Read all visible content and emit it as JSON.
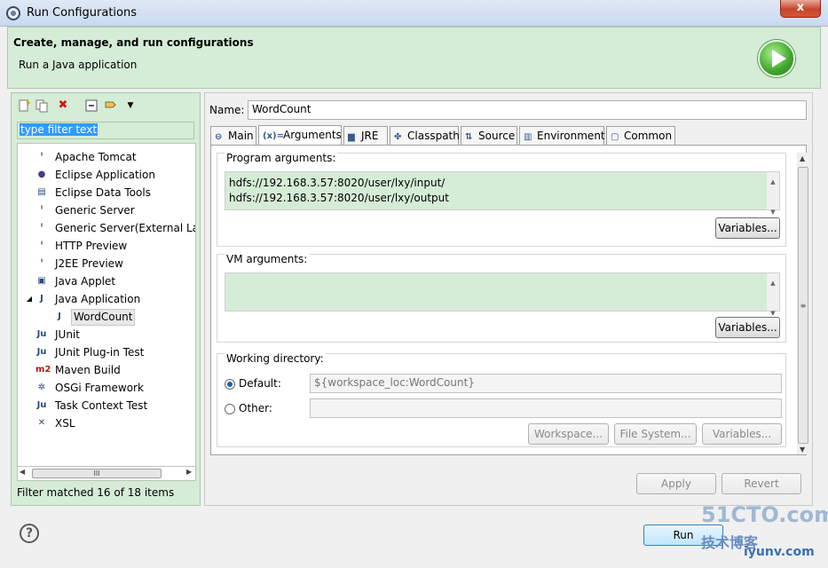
{
  "window": {
    "title": "Run Configurations",
    "close": "x"
  },
  "header": {
    "title": "Create, manage, and run configurations",
    "subtitle": "Run a Java application"
  },
  "left": {
    "toolbar": [
      "new-launch-icon",
      "duplicate-icon",
      "delete-icon",
      "collapse-all-icon",
      "filter-icon",
      "chevron-down-icon"
    ],
    "filter_text": "type filter text",
    "tree": [
      {
        "label": "Apache Tomcat",
        "icon": "ᴵ",
        "depth": 1
      },
      {
        "label": "Eclipse Application",
        "icon": "●",
        "depth": 1
      },
      {
        "label": "Eclipse Data Tools",
        "icon": "▤",
        "depth": 1
      },
      {
        "label": "Generic Server",
        "icon": "ᴵ",
        "depth": 1
      },
      {
        "label": "Generic Server(External Lau",
        "icon": "ᴵ",
        "depth": 1
      },
      {
        "label": "HTTP Preview",
        "icon": "ᴵ",
        "depth": 1
      },
      {
        "label": "J2EE Preview",
        "icon": "ᴵ",
        "depth": 1
      },
      {
        "label": "Java Applet",
        "icon": "▣",
        "depth": 1
      },
      {
        "label": "Java Application",
        "icon": "J",
        "depth": 1,
        "expanded": true
      },
      {
        "label": "WordCount",
        "icon": "J",
        "depth": 2,
        "selected": true
      },
      {
        "label": "JUnit",
        "icon": "Ju",
        "depth": 1
      },
      {
        "label": "JUnit Plug-in Test",
        "icon": "Ju",
        "depth": 1
      },
      {
        "label": "Maven Build",
        "icon": "m2",
        "depth": 1
      },
      {
        "label": "OSGi Framework",
        "icon": "✲",
        "depth": 1
      },
      {
        "label": "Task Context Test",
        "icon": "Ju",
        "depth": 1
      },
      {
        "label": "XSL",
        "icon": "✕",
        "depth": 1
      }
    ],
    "scroll_mark": "III",
    "status": "Filter matched 16 of 18 items"
  },
  "right": {
    "name_label": "Name:",
    "name_value": "WordCount",
    "tabs": [
      {
        "label": "Main",
        "icon": "⊖"
      },
      {
        "label": "Arguments",
        "icon": "(x)="
      },
      {
        "label": "JRE",
        "icon": "▆"
      },
      {
        "label": "Classpath",
        "icon": "✤"
      },
      {
        "label": "Source",
        "icon": "⇅"
      },
      {
        "label": "Environment",
        "icon": "▥"
      },
      {
        "label": "Common",
        "icon": "▢"
      }
    ],
    "program_args_label": "Program arguments:",
    "program_args_line1": "hdfs://192.168.3.57:8020/user/lxy/input/",
    "program_args_line2": "hdfs://192.168.3.57:8020/user/lxy/output",
    "vm_args_label": "VM arguments:",
    "variables_label": "Variables...",
    "working_dir_label": "Working directory:",
    "default_label": "Default:",
    "default_value": "${workspace_loc:WordCount}",
    "other_label": "Other:",
    "workspace_btn": "Workspace...",
    "filesystem_btn": "File System...",
    "variables_btn2": "Variables...",
    "apply_btn": "Apply",
    "revert_btn": "Revert",
    "run_btn": "Run"
  },
  "watermark": {
    "line1": "51CTO.com",
    "line2": "技术博客",
    "line3": "iyunv.com"
  },
  "colors": {
    "accent_green": "#d5ecd6",
    "selection": "#3399ff"
  }
}
